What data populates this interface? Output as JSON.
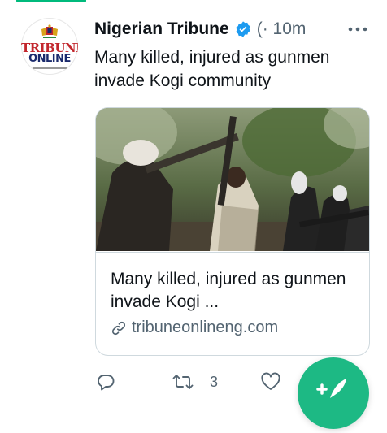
{
  "tweet": {
    "author_name": "Nigerian Tribune",
    "handle_time": "(· 10m",
    "text": "Many killed, injured as gunmen invade Kogi community",
    "avatar_logo_line1": "TRIBUNE",
    "avatar_logo_line2": "ONLINE"
  },
  "card": {
    "title": "Many killed, injured as gunmen invade Kogi ...",
    "domain": "tribuneonlineng.com"
  },
  "actions": {
    "retweet_count": "3"
  },
  "colors": {
    "verified": "#1d9bf0",
    "accent_green": "#00ba7c",
    "fab_green": "#1db984",
    "secondary_text": "#536471"
  },
  "icons": [
    "verified-badge-icon",
    "more-icon",
    "link-icon",
    "reply-icon",
    "retweet-icon",
    "like-icon",
    "compose-icon"
  ]
}
